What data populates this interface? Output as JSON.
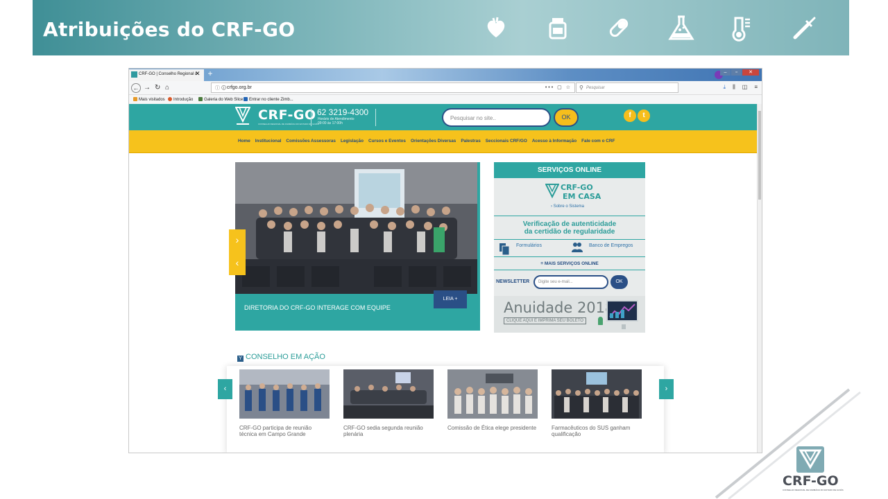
{
  "slide": {
    "title": "Atribuições do CRF-GO",
    "header_icons": [
      "heart-icon",
      "pill-bottle-icon",
      "capsule-icon",
      "flask-icon",
      "thermometer-icon",
      "pipette-icon"
    ]
  },
  "browser": {
    "tab_title": "CRF-GO | Conselho Regional d",
    "tab_close": "✕",
    "new_tab": "+",
    "url": "crfgo.org.br",
    "url_info": "ⓘ 🛈",
    "url_actions": "••• ▢ ☆",
    "search_placeholder": "Pesquisar",
    "bookmarks": [
      "Mais visitados",
      "Introdução",
      "Galeria do Web Slice",
      "Entrar no cliente Zimb..."
    ]
  },
  "site": {
    "brand": "CRF-GO",
    "brand_sub": "CONSELHO REGIONAL DE FARMÁCIA DO ESTADO DE GOIÁS",
    "phone": "62 3219-4300",
    "hours_label": "Horário de Atendimento",
    "hours": "09:00 às 17:00h",
    "search_placeholder": "Pesquisar no site..",
    "search_button": "OK",
    "social": [
      "f",
      "t"
    ],
    "menu": [
      "Home",
      "Institucional",
      "Comissões Assessoras",
      "Legislação",
      "Cursos e Eventos",
      "Orientações Diversas",
      "Palestras",
      "Seccionais CRF/GO",
      "Acesso à Informação",
      "Fale com o CRF"
    ],
    "hero": {
      "caption": "DIRETORIA DO CRF-GO INTERAGE COM EQUIPE",
      "read_more": "LEIA +",
      "next": "›",
      "prev": "‹"
    },
    "services": {
      "title": "SERVIÇOS ONLINE",
      "casa_line1": "CRF-GO",
      "casa_line2": "EM CASA",
      "casa_link": "› Sobre o Sistema",
      "verify_line1": "Verificação de autenticidade",
      "verify_line2": "da certidão de regularidade",
      "forms": "Formulários",
      "jobs": "Banco de Empregos",
      "more": "≡ MAIS SERVIÇOS ONLINE",
      "newsletter_label": "NEWSLETTER",
      "newsletter_placeholder": "Digite seu e-mail...",
      "newsletter_button": "OK",
      "annuity_title": "Anuidade 2018",
      "annuity_sub": "CLIQUE AQUI E IMPRIMA SEU BOLETO"
    },
    "council": {
      "title": "CONSELHO EM AÇÃO",
      "prev": "‹",
      "next": "›",
      "news": [
        {
          "text": "CRF-GO participa de reunião técnica em Campo Grande"
        },
        {
          "text": "CRF-GO sedia segunda reunião plenária"
        },
        {
          "text": "Comissão de Ética elege presidente"
        },
        {
          "text": "Farmacêuticos do SUS ganham qualificação"
        }
      ]
    }
  },
  "footer": {
    "brand": "CRF-GO",
    "brand_sub": "CONSELHO REGIONAL DE FARMÁCIA DO ESTADO DE GOIÁS"
  },
  "colors": {
    "teal": "#2ea6a2",
    "yellow": "#f6c21c",
    "navy": "#2a4f86"
  }
}
